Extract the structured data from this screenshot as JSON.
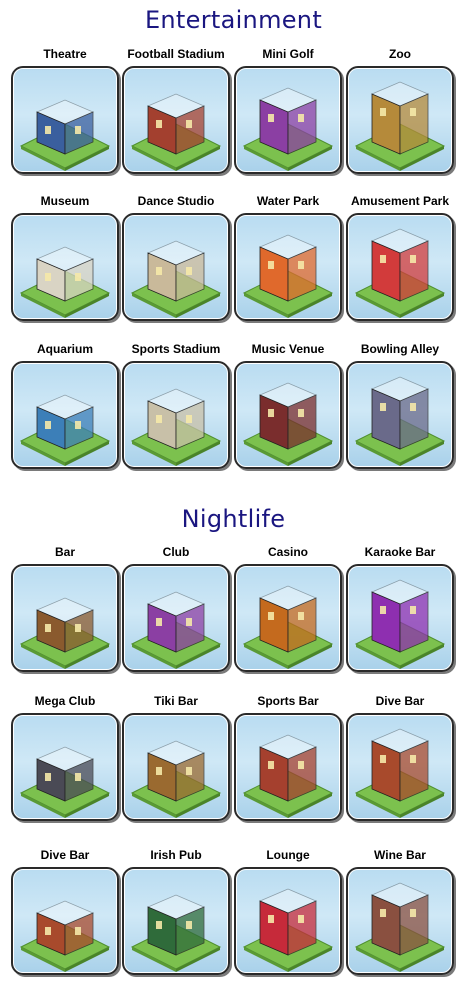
{
  "sections": [
    {
      "title": "Entertainment",
      "items": [
        {
          "label": "Theatre",
          "icon": "theatre-icon",
          "color": "#3a5f9e"
        },
        {
          "label": "Football Stadium",
          "icon": "football-stadium-icon",
          "color": "#a3402f"
        },
        {
          "label": "Mini Golf",
          "icon": "mini-golf-icon",
          "color": "#8b3fa3"
        },
        {
          "label": "Zoo",
          "icon": "zoo-icon",
          "color": "#b58a3a"
        },
        {
          "label": "Museum",
          "icon": "museum-icon",
          "color": "#d9d4c4"
        },
        {
          "label": "Dance Studio",
          "icon": "dance-studio-icon",
          "color": "#c9b99a"
        },
        {
          "label": "Water Park",
          "icon": "water-park-icon",
          "color": "#e0692c"
        },
        {
          "label": "Amusement Park",
          "icon": "amusement-park-icon",
          "color": "#d23b3b"
        },
        {
          "label": "Aquarium",
          "icon": "aquarium-icon",
          "color": "#3c7fb8"
        },
        {
          "label": "Sports Stadium",
          "icon": "sports-stadium-icon",
          "color": "#c8c0a8"
        },
        {
          "label": "Music Venue",
          "icon": "music-venue-icon",
          "color": "#7a2d2d"
        },
        {
          "label": "Bowling Alley",
          "icon": "bowling-alley-icon",
          "color": "#6a6a8a"
        }
      ]
    },
    {
      "title": "Nightlife",
      "items": [
        {
          "label": "Bar",
          "icon": "bar-icon",
          "color": "#8a5a2e"
        },
        {
          "label": "Club",
          "icon": "club-icon",
          "color": "#8b3fa3"
        },
        {
          "label": "Casino",
          "icon": "casino-icon",
          "color": "#c46a1e"
        },
        {
          "label": "Karaoke Bar",
          "icon": "karaoke-bar-icon",
          "color": "#8e2fb0"
        },
        {
          "label": "Mega Club",
          "icon": "mega-club-icon",
          "color": "#4a4a55"
        },
        {
          "label": "Tiki Bar",
          "icon": "tiki-bar-icon",
          "color": "#9a6a30"
        },
        {
          "label": "Sports Bar",
          "icon": "sports-bar-icon",
          "color": "#a5402e"
        },
        {
          "label": "Dive Bar",
          "icon": "dive-bar-icon",
          "color": "#a84a2c"
        },
        {
          "label": "Dive Bar",
          "icon": "dive-bar-icon",
          "color": "#a84a2c"
        },
        {
          "label": "Irish Pub",
          "icon": "irish-pub-icon",
          "color": "#2f6b3a"
        },
        {
          "label": "Lounge",
          "icon": "lounge-icon",
          "color": "#c62a3a"
        },
        {
          "label": "Wine Bar",
          "icon": "wine-bar-icon",
          "color": "#8a5040"
        }
      ]
    }
  ]
}
